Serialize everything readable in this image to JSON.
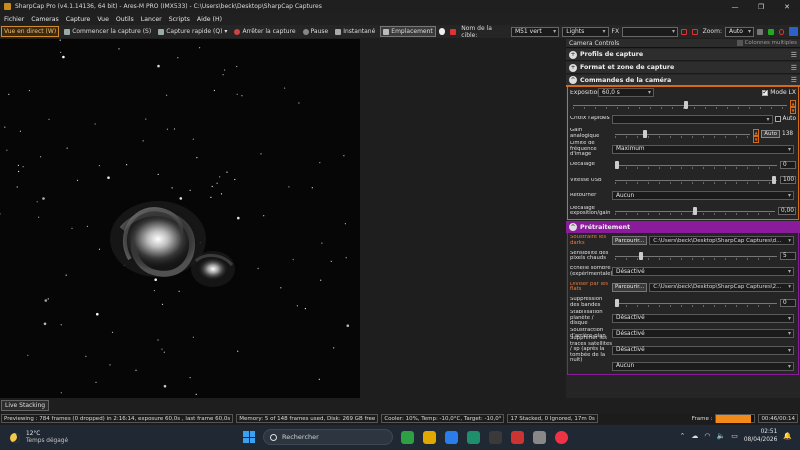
{
  "window": {
    "title": "SharpCap Pro (v4.1.14136, 64 bit) - Ares-M PRO (IMX533) - C:\\Users\\beck\\Desktop\\SharpCap Captures",
    "controls": [
      "—",
      "❐",
      "✕"
    ]
  },
  "menu": [
    "Fichier",
    "Cameras",
    "Capture",
    "Vue",
    "Outils",
    "Lancer",
    "Scripts",
    "Aide (H)"
  ],
  "toolbar": {
    "live": "Vue en direct (W)",
    "start_capture": "Commencer la capture (S)",
    "quick_capture": "Capture rapide (Q)",
    "stop_capture": "Arrêter la capture",
    "pause": "Pause",
    "snapshot": "Instantané",
    "placement": "Emplacement",
    "target_label": "Nom de la cible:",
    "target_value": "M51 vert",
    "frame_type": "Lights",
    "fx_label": "FX",
    "fx_value": "",
    "zoom_label": "Zoom:",
    "zoom_value": "Auto"
  },
  "panel": {
    "header": "Camera Controls",
    "multi_columns": "Colonnes multiples",
    "sections": {
      "profiles": "Profils de capture",
      "format": "Format et zone de capture",
      "camera": "Commandes de la caméra",
      "preprocessing": "Prétraitement"
    },
    "camera": {
      "exposure_label": "Exposition",
      "exposure_value": "60,0 s",
      "lx_label": "Mode LX",
      "quick_choice_label": "Choix rapides",
      "quick_choice_value": "",
      "auto_label": "Auto",
      "gain_label": "Gain analogique",
      "gain_auto": "Auto",
      "gain_value": "138",
      "freq_label": "Limite de fréquence d'image",
      "freq_value": "Maximum",
      "offset_label": "Décalage",
      "offset_value": "0",
      "usb_label": "Vitesse USB",
      "usb_value": "100",
      "flip_label": "Retourner",
      "flip_value": "Aucun",
      "expgain_label": "Décalage exposition/gain",
      "expgain_value": "0,00"
    },
    "pre": {
      "darks_label": "Soustraire les darks",
      "browse": "Parcourir...",
      "darks_path": "C:\\Users\\beck\\Desktop\\SharpCap Captures\\d...",
      "hot_label": "Sensibilité des pixels chauds",
      "hot_value": "5",
      "dark_scale_label": "Echelle sombre (expérimentale)",
      "dark_scale_value": "Désactivé",
      "flats_label": "Diviser par les flats",
      "flats_path": "C:\\Users\\beck\\Desktop\\SharpCap Captures\\2...",
      "bands_label": "Suppression des bandes",
      "bands_value": "0",
      "planet_label": "Stabilisation planète / disque",
      "planet_value": "Désactivé",
      "bg_label": "Soustraction d'arrière-plan",
      "bg_value": "Désactivé",
      "sat_label": "Supprimer les traces satellites / sp (après la tombée de la nuit)",
      "sat_value": "Désactivé",
      "last_value": "Aucun"
    }
  },
  "status": {
    "live_stacking": "Live Stacking",
    "previewing": "Previewing : 784 frames (0 dropped) in 2:16:14, exposure 60,0s , last frame 60,0s",
    "memory": "Memory: 5 of 148 frames used, Disk: 269 GB free",
    "cooler": "Cooler: 10%, Temp: -10,0°C, Target: -10,0°",
    "stacked": "17 Stacked, 0 Ignored, 17m 0s",
    "frame_label": "Frame :",
    "frame_progress": 0.9,
    "frame_time": "00:46/00:14"
  },
  "taskbar": {
    "temp": "12°C",
    "weather": "Temps dégagé",
    "search": "Rechercher",
    "time": "02:51",
    "date": "08/04/2026",
    "app_colors": [
      "#2ea043",
      "#e0a800",
      "#2b7de9",
      "#1f8f6b",
      "#3a3a3a",
      "#c33",
      "#888",
      "#e34"
    ]
  },
  "colors": {
    "accent": "#d36b1a",
    "preprocessing": "#8a1b9a",
    "progress": "#f08a1a"
  }
}
